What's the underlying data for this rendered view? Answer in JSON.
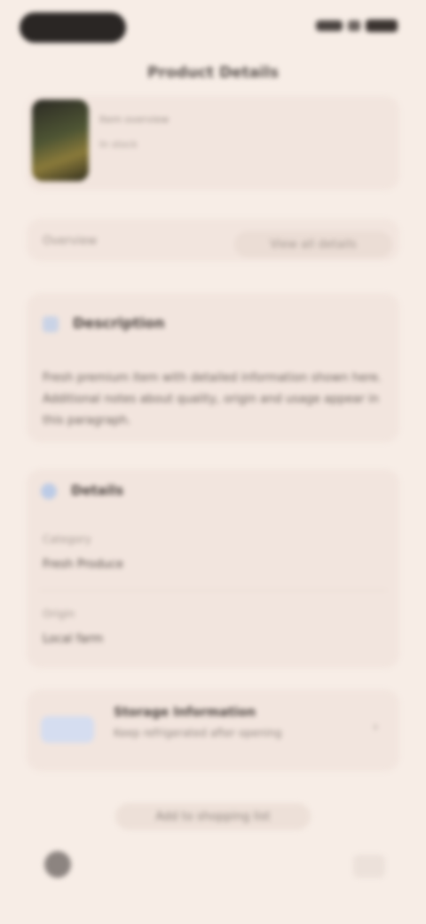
{
  "status_bar": {},
  "header": {
    "title": "Product Details"
  },
  "product": {
    "subtitle": "Item overview",
    "secondary": "In stock"
  },
  "action_row": {
    "left_label": "Overview",
    "right_label": "View all details"
  },
  "description": {
    "title": "Description",
    "text": "Fresh premium item with detailed information shown here. Additional notes about quality, origin and usage appear in this paragraph."
  },
  "details": {
    "title": "Details",
    "rows": [
      {
        "label": "Category",
        "value": "Fresh Produce"
      },
      {
        "label": "Origin",
        "value": "Local farm"
      }
    ]
  },
  "info": {
    "title": "Storage Information",
    "text": "Keep refrigerated after opening"
  },
  "cta": {
    "label": "Add to shopping list"
  }
}
